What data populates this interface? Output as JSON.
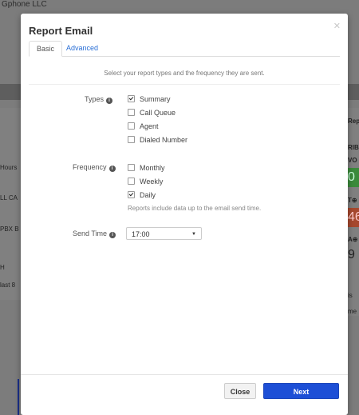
{
  "background": {
    "company": "Gphone LLC",
    "left_items": [
      "Hours",
      "LL CA",
      "PBX B",
      "H",
      "last 8"
    ],
    "right_items": [
      "Rep",
      "RIB",
      "VO",
      "T⊕",
      "A⊕",
      "is",
      "me"
    ],
    "green_value": "0",
    "red_value": "46",
    "big_value": "9"
  },
  "modal": {
    "title": "Report Email",
    "close_icon": "close-icon",
    "tabs": [
      {
        "label": "Basic",
        "active": true
      },
      {
        "label": "Advanced",
        "active": false
      }
    ],
    "description": "Select your report types and the frequency they are sent.",
    "types": {
      "label": "Types",
      "options": [
        {
          "label": "Summary",
          "checked": true
        },
        {
          "label": "Call Queue",
          "checked": false
        },
        {
          "label": "Agent",
          "checked": false
        },
        {
          "label": "Dialed Number",
          "checked": false
        }
      ]
    },
    "frequency": {
      "label": "Frequency",
      "options": [
        {
          "label": "Monthly",
          "checked": false
        },
        {
          "label": "Weekly",
          "checked": false
        },
        {
          "label": "Daily",
          "checked": true
        }
      ],
      "hint": "Reports include data up to the email send time."
    },
    "send_time": {
      "label": "Send Time",
      "value": "17:00"
    },
    "buttons": {
      "close": "Close",
      "next": "Next"
    },
    "colors": {
      "primary": "#1d4fd6",
      "link": "#2a6fd6"
    }
  }
}
